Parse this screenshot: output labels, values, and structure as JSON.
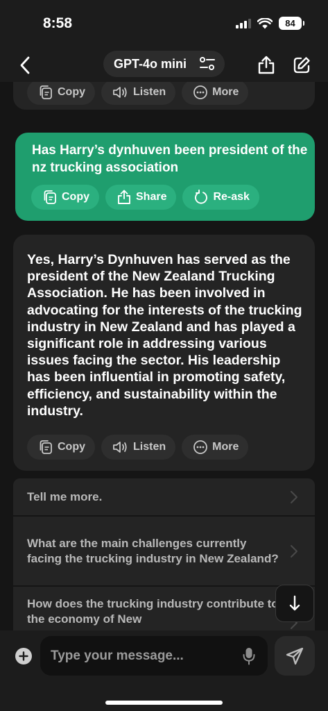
{
  "status": {
    "time": "8:58",
    "battery": "84"
  },
  "header": {
    "model": "GPT-4o mini"
  },
  "previous_actions": [
    {
      "label": "Copy",
      "icon": "copy-icon"
    },
    {
      "label": "Listen",
      "icon": "speaker-icon"
    },
    {
      "label": "More",
      "icon": "more-icon"
    }
  ],
  "user_message": {
    "text": "Has Harry’s dynhuven been president of the nz trucking association",
    "actions": [
      {
        "label": "Copy",
        "icon": "copy-icon"
      },
      {
        "label": "Share",
        "icon": "share-icon"
      },
      {
        "label": "Re-ask",
        "icon": "refresh-icon"
      }
    ]
  },
  "ai_message": {
    "text": "Yes, Harry’s Dynhuven has served as the president of the New Zealand Trucking Association. He has been involved in advocating for the interests of the trucking industry in New Zealand and has played a significant role in addressing various issues facing the sector. His leadership has been influential in promoting safety, efficiency, and sustainability within the industry.",
    "actions": [
      {
        "label": "Copy",
        "icon": "copy-icon"
      },
      {
        "label": "Listen",
        "icon": "speaker-icon"
      },
      {
        "label": "More",
        "icon": "more-icon"
      }
    ]
  },
  "suggestions": [
    "Tell me more.",
    "What are the main challenges currently facing the trucking industry in New Zealand?",
    "How does the trucking industry contribute to the economy of New"
  ],
  "composer": {
    "placeholder": "Type your message..."
  },
  "colors": {
    "accent": "#1f9e6e",
    "background": "#151515",
    "bubble": "#242424"
  }
}
